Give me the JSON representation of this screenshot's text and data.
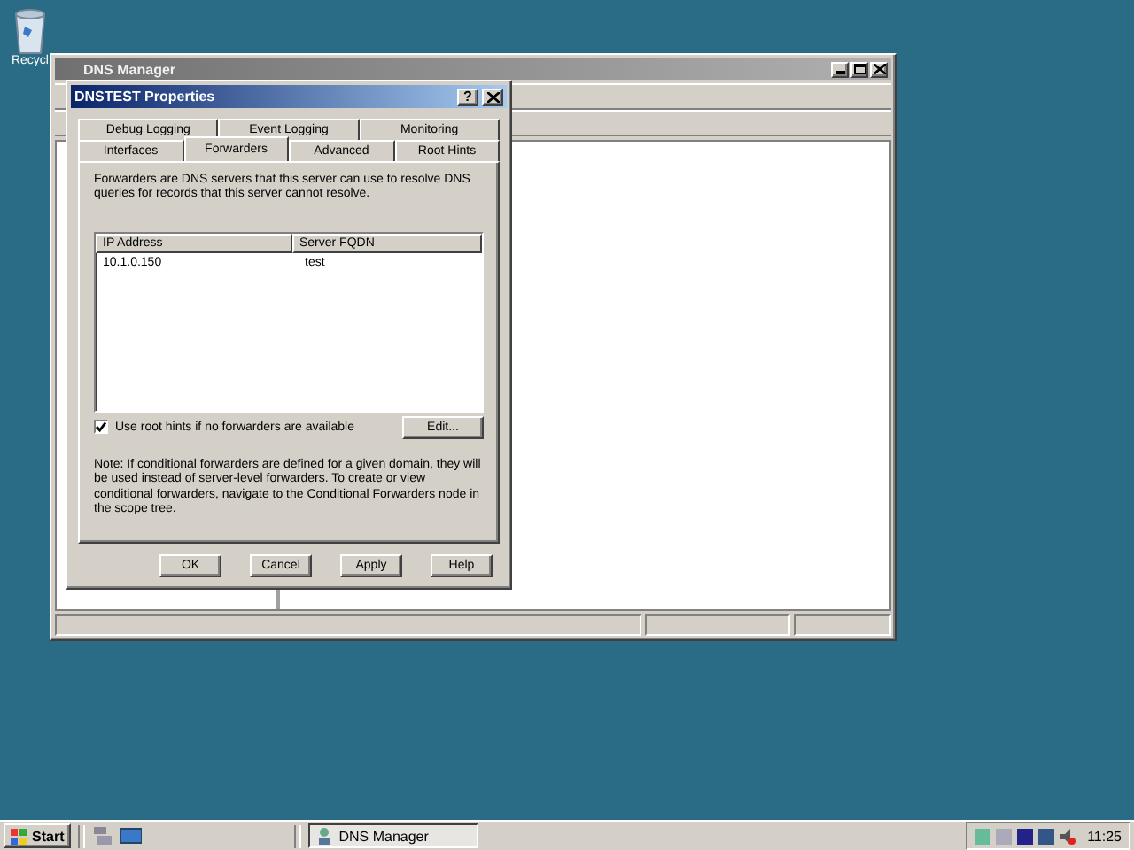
{
  "desktop_icons": [
    {
      "label": "Recycl"
    }
  ],
  "background_window": {
    "title": "DNS Manager"
  },
  "dialog": {
    "title": "DNSTEST Properties",
    "help_button": "?",
    "tab_rows": [
      [
        {
          "label": "Debug Logging",
          "selected": false
        },
        {
          "label": "Event Logging",
          "selected": false
        },
        {
          "label": "Monitoring",
          "selected": false
        }
      ],
      [
        {
          "label": "Interfaces",
          "selected": false
        },
        {
          "label": "Forwarders",
          "selected": true
        },
        {
          "label": "Advanced",
          "selected": false
        },
        {
          "label": "Root Hints",
          "selected": false
        }
      ]
    ],
    "description": "Forwarders are DNS servers that this server can use to resolve DNS queries for records that this server cannot resolve.",
    "table": {
      "columns": [
        "IP Address",
        "Server FQDN"
      ],
      "rows": [
        [
          "10.1.0.150",
          "test"
        ]
      ]
    },
    "root_hints": {
      "label": "Use root hints if no forwarders are available",
      "checked": true
    },
    "edit_button": "Edit...",
    "note": "Note: If conditional forwarders are defined for a given domain, they will be used instead of server-level forwarders.  To create or view conditional forwarders, navigate to the Conditional Forwarders node in the scope tree.",
    "buttons": [
      "OK",
      "Cancel",
      "Apply",
      "Help"
    ]
  },
  "taskbar": {
    "start": "Start",
    "tasks": [
      {
        "label": "DNS Manager",
        "selected": true
      }
    ],
    "clock": "11:25"
  }
}
